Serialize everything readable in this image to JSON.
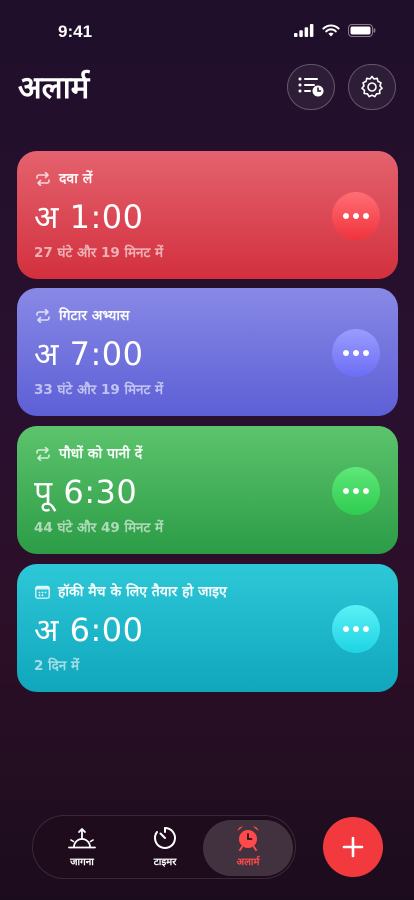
{
  "status_bar": {
    "time": "9:41"
  },
  "header": {
    "title": "अलार्म"
  },
  "alarms": [
    {
      "label": "दवा लें",
      "label_icon": "repeat-icon",
      "prefix": "अ",
      "time": "1:00",
      "subtitle": "27 घंटे और 19 मिनट में",
      "color": "#d9404c"
    },
    {
      "label": "गिटार अभ्यास",
      "label_icon": "repeat-icon",
      "prefix": "अ",
      "time": "7:00",
      "subtitle": "33 घंटे और 19 मिनट में",
      "color": "#6e70dc"
    },
    {
      "label": "पौधों को पानी दें",
      "label_icon": "repeat-icon",
      "prefix": "पू",
      "time": "6:30",
      "subtitle": "44 घंटे और 49 मिनट में",
      "color": "#3aab52"
    },
    {
      "label": "हॉकी मैच के लिए तैयार हो जाइए",
      "label_icon": "calendar-icon",
      "prefix": "अ",
      "time": "6:00",
      "subtitle": "2 दिन में",
      "color": "#1ab4c8"
    }
  ],
  "tabs": [
    {
      "label": "जागना",
      "icon": "sunrise-icon"
    },
    {
      "label": "टाइमर",
      "icon": "timer-icon"
    },
    {
      "label": "अलार्म",
      "icon": "alarm-clock-icon",
      "active": true
    }
  ],
  "fab": {
    "icon": "plus-icon"
  },
  "colors": {
    "accent": "#f2393d"
  }
}
